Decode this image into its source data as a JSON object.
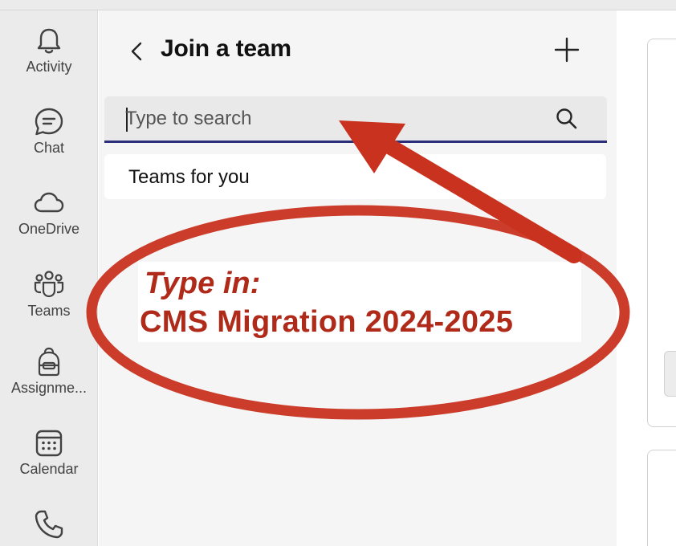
{
  "rail": {
    "items": [
      {
        "label": "Activity",
        "icon": "bell-icon"
      },
      {
        "label": "Chat",
        "icon": "chat-icon"
      },
      {
        "label": "OneDrive",
        "icon": "cloud-icon"
      },
      {
        "label": "Teams",
        "icon": "teams-icon"
      },
      {
        "label": "Assignme...",
        "icon": "backpack-icon"
      },
      {
        "label": "Calendar",
        "icon": "calendar-icon"
      },
      {
        "label": "",
        "icon": "phone-icon"
      }
    ]
  },
  "panel": {
    "title": "Join a team",
    "search_placeholder": "Type to search",
    "search_value": "",
    "teams_for_you": "Teams for you"
  },
  "annotation": {
    "line1": "Type in:",
    "line2": "CMS Migration 2024-2025",
    "color": "#c9321f"
  },
  "colors": {
    "rail_bg": "#ebebeb",
    "panel_bg": "#f5f5f5",
    "search_underline": "#2b2f7a",
    "annotation_red": "#c9321f"
  }
}
